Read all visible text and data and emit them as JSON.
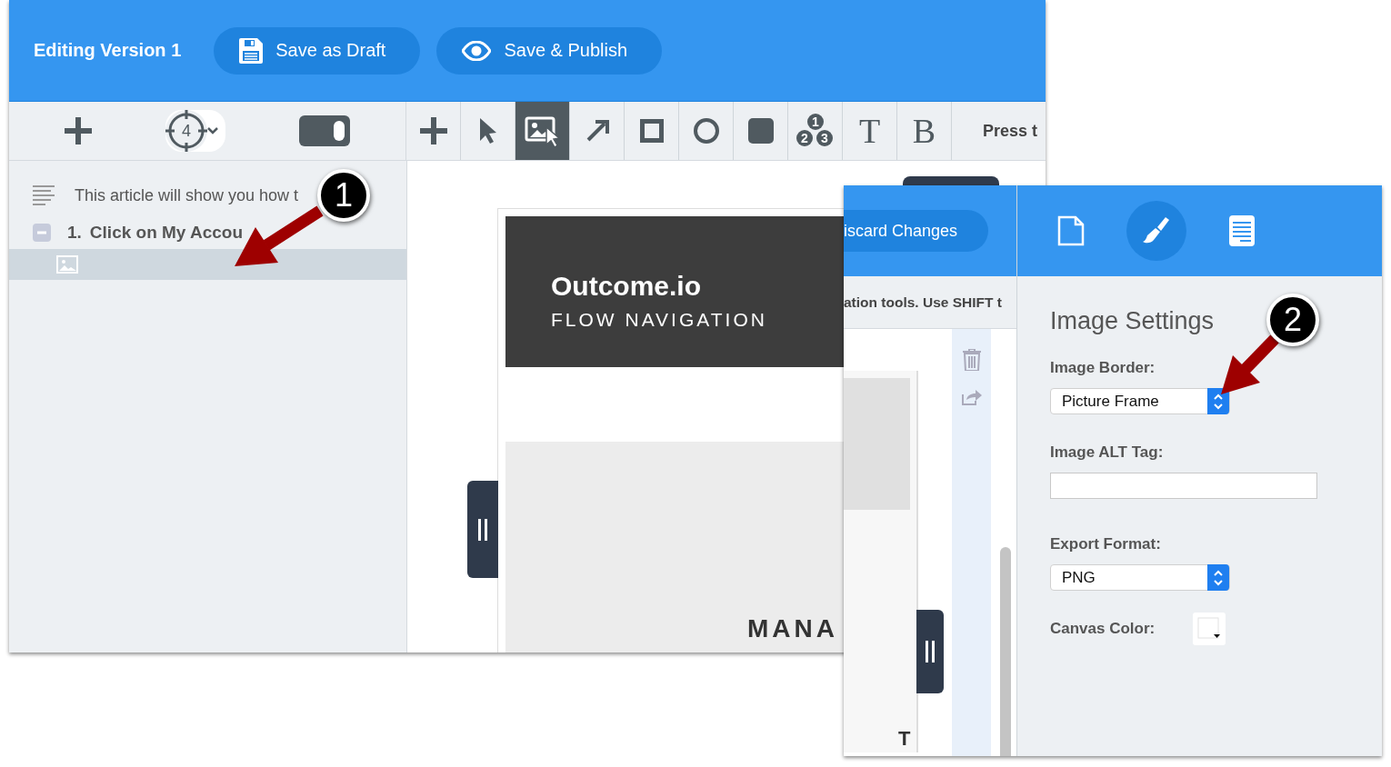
{
  "editor": {
    "title": "Editing Version 1",
    "buttons": [
      {
        "kind": "save",
        "label": "Save as Draft"
      },
      {
        "kind": "publish",
        "label": "Save & Publish"
      }
    ],
    "left_toolbar": {
      "marker_count": "4",
      "toggle_on": true
    },
    "tools": [
      {
        "kind": "add",
        "selected": false
      },
      {
        "kind": "pointer",
        "selected": false
      },
      {
        "kind": "image",
        "selected": true
      },
      {
        "kind": "arrow",
        "selected": false
      },
      {
        "kind": "square",
        "selected": false
      },
      {
        "kind": "circle",
        "selected": false
      },
      {
        "kind": "filled",
        "selected": false
      },
      {
        "kind": "numbers",
        "selected": false,
        "labels": [
          "1",
          "2",
          "3"
        ]
      },
      {
        "kind": "text",
        "selected": false,
        "label": "T"
      },
      {
        "kind": "bold",
        "selected": false,
        "label": "B"
      }
    ],
    "hint": "Press t",
    "outline": [
      {
        "kind": "text",
        "label": "This article will show you how t"
      },
      {
        "kind": "step",
        "number": "1.",
        "label": "Click on My Accou",
        "expanded": true,
        "children": [
          {
            "kind": "image",
            "selected": true
          }
        ]
      }
    ],
    "canvas": {
      "brand": "Outcome.io",
      "subtitle": "FLOW NAVIGATION",
      "footer_text": "MANA"
    }
  },
  "settings_window": {
    "discard": "iscard Changes",
    "hint": "ation tools. Use SHIFT t",
    "corner_text": "T",
    "tabs": [
      {
        "kind": "page",
        "selected": false
      },
      {
        "kind": "style",
        "selected": true
      },
      {
        "kind": "document",
        "selected": false
      }
    ],
    "title": "Image Settings",
    "fields": [
      {
        "kind": "select",
        "label": "Image Border:",
        "value": "Picture Frame"
      },
      {
        "kind": "text",
        "label": "Image ALT Tag:"
      },
      {
        "kind": "select",
        "label": "Export Format:",
        "value": "PNG"
      },
      {
        "kind": "color",
        "label": "Canvas Color:"
      }
    ]
  },
  "callouts": [
    "1",
    "2"
  ]
}
